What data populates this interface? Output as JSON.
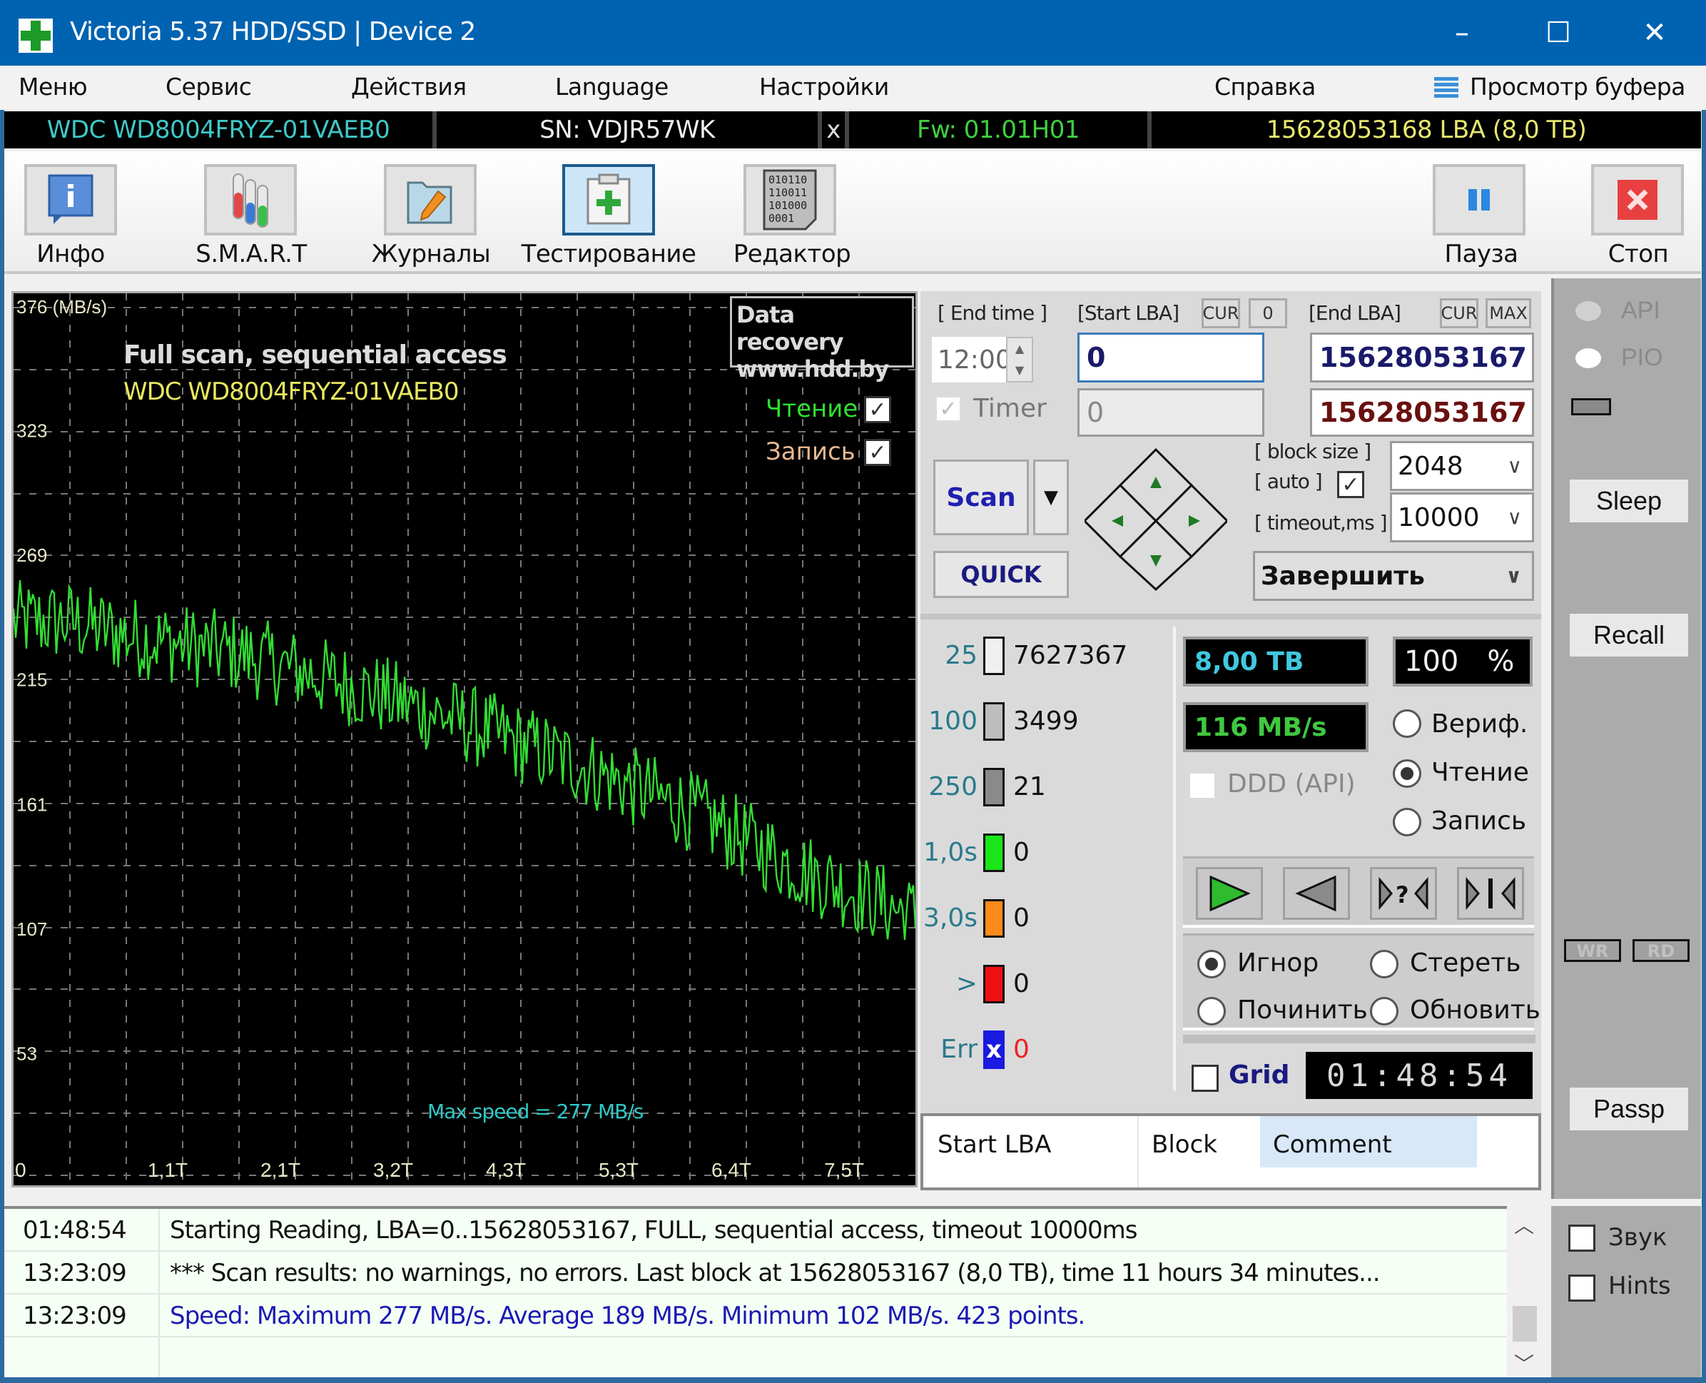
{
  "window": {
    "title": "Victoria 5.37 HDD/SSD | Device 2",
    "minimize": "–",
    "maximize": "☐",
    "close": "✕"
  },
  "menu": {
    "items": [
      "Меню",
      "Сервис",
      "Действия",
      "Language",
      "Настройки",
      "Справка"
    ],
    "buffer_view": "Просмотр буфера"
  },
  "device": {
    "model": "WDC WD8004FRYZ-01VAEB0",
    "serial": "SN: VDJR57WK",
    "x": "x",
    "firmware": "Fw: 01.01H01",
    "capacity": "15628053168 LBA (8,0 TB)"
  },
  "toolbar": {
    "info": "Инфо",
    "smart": "S.M.A.R.T",
    "logs": "Журналы",
    "testing": "Тестирование",
    "editor": "Редактор",
    "pause": "Пауза",
    "stop": "Стоп",
    "editor_icon_text": [
      "010110",
      "110011",
      "101000",
      "0001"
    ]
  },
  "graph": {
    "title": "Full scan, sequential access",
    "model": "WDC WD8004FRYZ-01VAEB0",
    "watermark_line1": "Data recovery",
    "watermark_line2": "www.hdd.by",
    "read_label": "Чтение",
    "write_label": "Запись",
    "read_checked": true,
    "write_checked": true,
    "max_speed_note": "Max speed = 277 MB/s"
  },
  "chart_data": {
    "type": "line",
    "title": "Full scan, sequential access",
    "ylabel": "MB/s",
    "ylim": [
      0,
      376
    ],
    "y_ticks": [
      {
        "value": 376,
        "label": "376 (MB/s)"
      },
      {
        "value": 323,
        "label": "323"
      },
      {
        "value": 269,
        "label": "269"
      },
      {
        "value": 215,
        "label": "215"
      },
      {
        "value": 161,
        "label": "161"
      },
      {
        "value": 107,
        "label": "107"
      },
      {
        "value": 53,
        "label": "53"
      }
    ],
    "x_ticks": [
      "0",
      "1,1T",
      "2,1T",
      "3,2T",
      "4,3T",
      "5,3T",
      "6,4T",
      "7,5T"
    ],
    "xlim_tb": [
      0,
      8.0
    ],
    "grid": true,
    "series": [
      {
        "name": "Чтение",
        "color": "#33dd33",
        "trend_points_tb_mbps": [
          [
            0,
            240
          ],
          [
            0.5,
            240
          ],
          [
            1.0,
            234
          ],
          [
            2.0,
            226
          ],
          [
            3.0,
            212
          ],
          [
            4.0,
            196
          ],
          [
            5.0,
            178
          ],
          [
            6.0,
            158
          ],
          [
            7.0,
            132
          ],
          [
            7.6,
            120
          ],
          [
            8.0,
            112
          ]
        ],
        "noise_amplitude": 18,
        "points": 423,
        "max": 277,
        "avg": 189,
        "min": 102
      }
    ]
  },
  "controls": {
    "end_time_label": "[ End time ]",
    "start_lba_label": "[Start LBA]",
    "end_lba_label": "[End LBA]",
    "cur": "CUR",
    "zero": "0",
    "max": "MAX",
    "end_time_value": "12:00",
    "start_lba_value": "0",
    "end_lba_value": "15628053167",
    "timer_label": "Timer",
    "timer_field": "0",
    "end_lba_current": "15628053167",
    "scan": "Scan",
    "quick": "QUICK",
    "block_size_label": "[ block size ]",
    "auto_label": "[ auto ]",
    "timeout_label": "[ timeout,ms ]",
    "block_size_value": "2048",
    "timeout_value": "10000",
    "finish_action": "Завершить"
  },
  "stats": {
    "legend": [
      {
        "label": "25",
        "color": "#f0f0f0",
        "count": "7627367"
      },
      {
        "label": "100",
        "color": "#bdbdbd",
        "count": "3499"
      },
      {
        "label": "250",
        "color": "#8a8a8a",
        "count": "21"
      },
      {
        "label": "1,0s",
        "color": "#19e619",
        "count": "0"
      },
      {
        "label": "3,0s",
        "color": "#ff8a1c",
        "count": "0"
      },
      {
        "label": ">",
        "color": "#ee1111",
        "count": "0"
      },
      {
        "label": "Err",
        "color": "#1a1ae0",
        "count": "0"
      }
    ],
    "size_display": "8,00 TB",
    "percent_display": "100",
    "percent_sign": "%",
    "speed_display": "116 MB/s",
    "ddd_label": "DDD (API)",
    "mode_verify": "Вериф.",
    "mode_read": "Чтение",
    "mode_write": "Запись",
    "selected_mode": "Чтение",
    "action_ignore": "Игнор",
    "action_erase": "Стереть",
    "action_repair": "Починить",
    "action_refresh": "Обновить",
    "selected_action": "Игнор",
    "grid_label": "Grid",
    "timer_display": "01:48:54"
  },
  "table": {
    "columns": [
      "Start LBA",
      "Block",
      "Comment"
    ]
  },
  "side": {
    "api": "API",
    "pio": "PIO",
    "sleep": "Sleep",
    "recall": "Recall",
    "wr": "WR",
    "rd": "RD",
    "passp": "Passp",
    "sound": "Звук",
    "hints": "Hints"
  },
  "log": [
    {
      "time": "01:48:54",
      "message": "Starting Reading, LBA=0..15628053167, FULL, sequential access, timeout 10000ms",
      "color": "#111111"
    },
    {
      "time": "13:23:09",
      "message": "*** Scan results: no warnings, no errors. Last block at 15628053167 (8,0 TB), time 11 hours 34 minutes...",
      "color": "#111111"
    },
    {
      "time": "13:23:09",
      "message": "Speed: Maximum 277 MB/s. Average 189 MB/s. Minimum 102 MB/s. 423 points.",
      "color": "#1a1ab4"
    }
  ]
}
